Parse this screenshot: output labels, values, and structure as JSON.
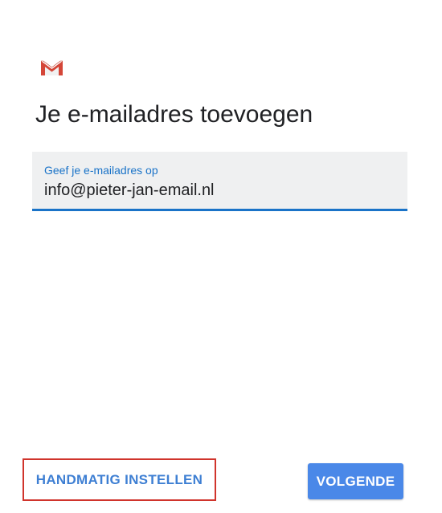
{
  "logo": {
    "icon": "gmail-icon",
    "colors": {
      "red": "#d44638",
      "white": "#ffffff"
    }
  },
  "title": "Je e-mailadres toevoegen",
  "email_field": {
    "label": "Geef je e-mailadres op",
    "value": "info@pieter-jan-email.nl"
  },
  "buttons": {
    "manual_label": "HANDMATIG INSTELLEN",
    "next_label": "VOLGENDE"
  },
  "colors": {
    "accent": "#1a73c8",
    "button_bg": "#4a88e8",
    "highlight_border": "#d0342c"
  }
}
